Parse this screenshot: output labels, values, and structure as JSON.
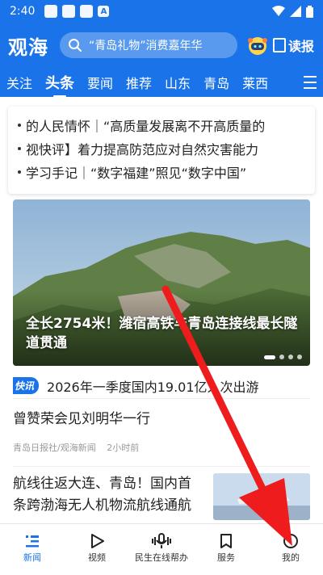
{
  "status_bar": {
    "time": "2:40"
  },
  "header": {
    "logo": "观海",
    "search_placeholder": "“青岛礼物”消费嘉年华",
    "reader_label": "读报"
  },
  "tabs": [
    {
      "label": "关注",
      "active": false
    },
    {
      "label": "头条",
      "active": true
    },
    {
      "label": "要闻",
      "active": false
    },
    {
      "label": "推荐",
      "active": false
    },
    {
      "label": "山东",
      "active": false
    },
    {
      "label": "青岛",
      "active": false
    },
    {
      "label": "莱西",
      "active": false
    }
  ],
  "headlines": [
    "的人民情怀｜“高质量发展离不开高质量的",
    "视快评】着力提高防范应对自然灾害能力",
    "学习手记｜“数字福建”照见“数字中国”"
  ],
  "banner": {
    "title": "全长2754米！潍宿高铁与青岛连接线最长隧道贯通"
  },
  "flash": {
    "badge": "快讯",
    "text": "2026年一季度国内19.01亿人次出游"
  },
  "news": [
    {
      "title": "曾赞荣会见刘明华一行",
      "source": "青岛日报社/观海新闻",
      "time": "2小时前"
    },
    {
      "title": "航线往返大连、青岛！国内首条跨渤海无人机物流航线通航"
    }
  ],
  "bottom_nav": [
    {
      "label": "新闻",
      "icon": "news-list-icon",
      "active": true
    },
    {
      "label": "视频",
      "icon": "play-icon",
      "active": false
    },
    {
      "label": "民生在线帮办",
      "icon": "microphone-icon",
      "active": false
    },
    {
      "label": "服务",
      "icon": "bookmark-icon",
      "active": false
    },
    {
      "label": "我的",
      "icon": "profile-icon",
      "active": false
    }
  ],
  "colors": {
    "brand_blue": "#1a73e8",
    "arrow_red": "#ee1c1c"
  }
}
